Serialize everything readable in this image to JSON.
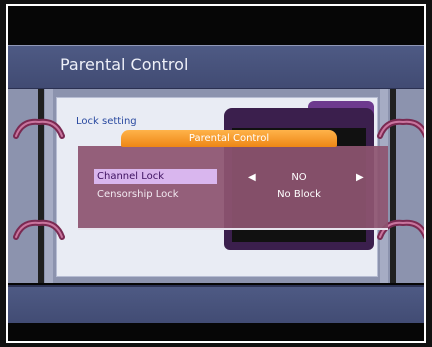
{
  "header": {
    "title": "Parental Control"
  },
  "background_panel": {
    "label": "Lock setting"
  },
  "dialog": {
    "title": "Parental Control",
    "rows": [
      {
        "label": "Channel Lock",
        "value": "NO",
        "selected": true
      },
      {
        "label": "Censorship Lock",
        "value": "No Block",
        "selected": false
      }
    ],
    "arrow_left": "◀",
    "arrow_right": "▶"
  },
  "colors": {
    "title_bar": "#4e5a84",
    "dialog_head": "#ee8615",
    "dialog_body": "#8d5470",
    "selected_row": "#d9b6ee",
    "screen_bg": "#060606"
  }
}
